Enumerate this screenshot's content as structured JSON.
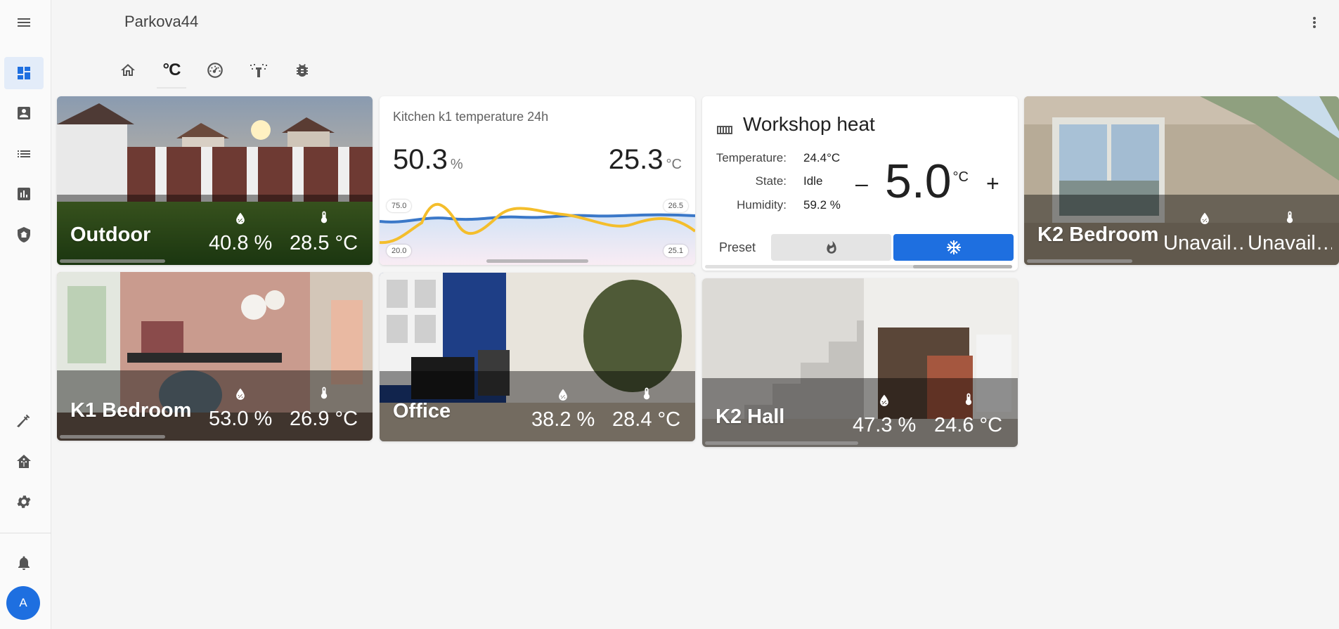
{
  "app": {
    "title": "Parkova44"
  },
  "user": {
    "avatar_letter": "A"
  },
  "tabs": [
    {
      "icon": "home-icon"
    },
    {
      "icon": "celsius-icon",
      "label": "°C"
    },
    {
      "icon": "gauge-icon"
    },
    {
      "icon": "sprinkler-icon"
    },
    {
      "icon": "bug-icon"
    }
  ],
  "cards": {
    "outdoor": {
      "name": "Outdoor",
      "humidity": "40.8 %",
      "temperature": "28.5 °C"
    },
    "k1_bedroom": {
      "name": "K1 Bedroom",
      "humidity": "53.0 %",
      "temperature": "26.9 °C"
    },
    "office": {
      "name": "Office",
      "humidity": "38.2 %",
      "temperature": "28.4 °C"
    },
    "k2_hall": {
      "name": "K2 Hall",
      "humidity": "47.3 %",
      "temperature": "24.6 °C"
    },
    "k2_bedroom": {
      "name": "K2 Bedroom",
      "humidity": "Unavail…",
      "temperature": "Unavail…"
    }
  },
  "kitchen": {
    "title": "Kitchen k1 temperature 24h",
    "humidity_value": "50.3",
    "humidity_unit": "%",
    "temp_value": "25.3",
    "temp_unit": "°C",
    "left_max": "75.0",
    "left_min": "20.0",
    "right_max": "26.5",
    "right_min": "25.1"
  },
  "thermostat": {
    "name": "Workshop heat",
    "temperature_label": "Temperature:",
    "temperature_value": "24.4°C",
    "state_label": "State:",
    "state_value": "Idle",
    "humidity_label": "Humidity:",
    "humidity_value": "59.2 %",
    "target": "5.0",
    "target_unit": "°C",
    "minus": "–",
    "plus": "+",
    "preset_label": "Preset",
    "preset_active": "cool"
  },
  "colors": {
    "accent": "#1e6fe0",
    "humidity_line": "#3b78c8",
    "temperature_line": "#f4be2c"
  }
}
